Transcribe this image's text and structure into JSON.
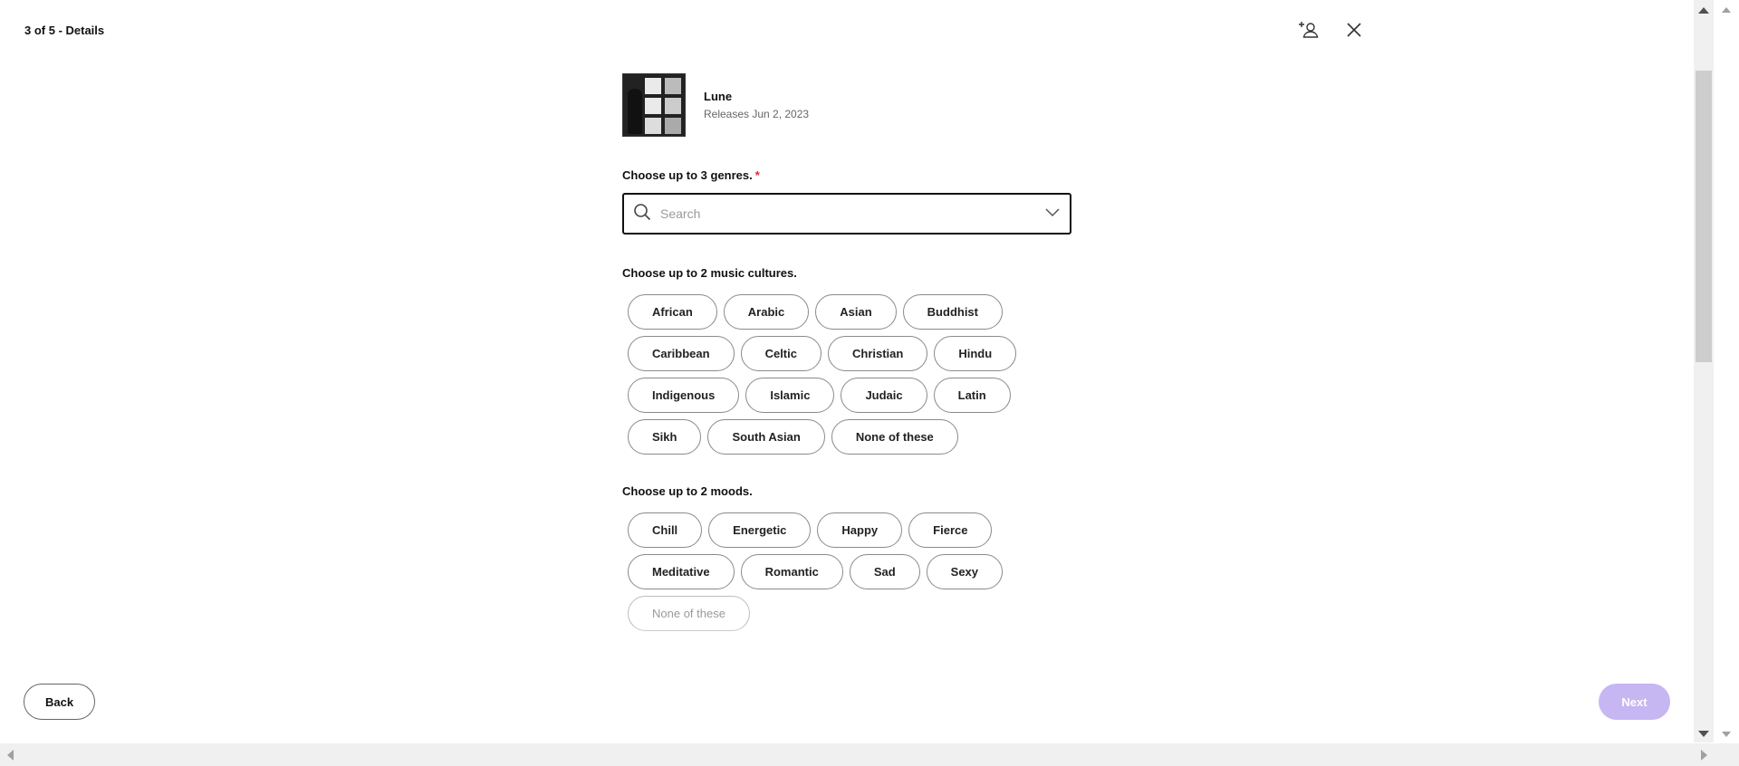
{
  "header": {
    "title": "3 of 5 - Details",
    "icons": [
      "add-user-icon",
      "close-icon"
    ]
  },
  "release": {
    "name": "Lune",
    "date": "Releases Jun 2, 2023"
  },
  "genres": {
    "label": "Choose up to 3 genres.",
    "required_mark": "*",
    "search_placeholder": "Search",
    "search_value": ""
  },
  "cultures": {
    "label": "Choose up to 2 music cultures.",
    "options": [
      "African",
      "Arabic",
      "Asian",
      "Buddhist",
      "Caribbean",
      "Celtic",
      "Christian",
      "Hindu",
      "Indigenous",
      "Islamic",
      "Judaic",
      "Latin",
      "Sikh",
      "South Asian",
      "None of these"
    ]
  },
  "moods": {
    "label": "Choose up to 2 moods.",
    "options": [
      "Chill",
      "Energetic",
      "Happy",
      "Fierce",
      "Meditative",
      "Romantic",
      "Sad",
      "Sexy",
      "None of these"
    ]
  },
  "footer": {
    "back_label": "Back",
    "next_label": "Next",
    "next_color": "#c6b6f2"
  },
  "colors": {
    "required": "#e0293a",
    "text": "#111111",
    "muted": "#666666"
  }
}
